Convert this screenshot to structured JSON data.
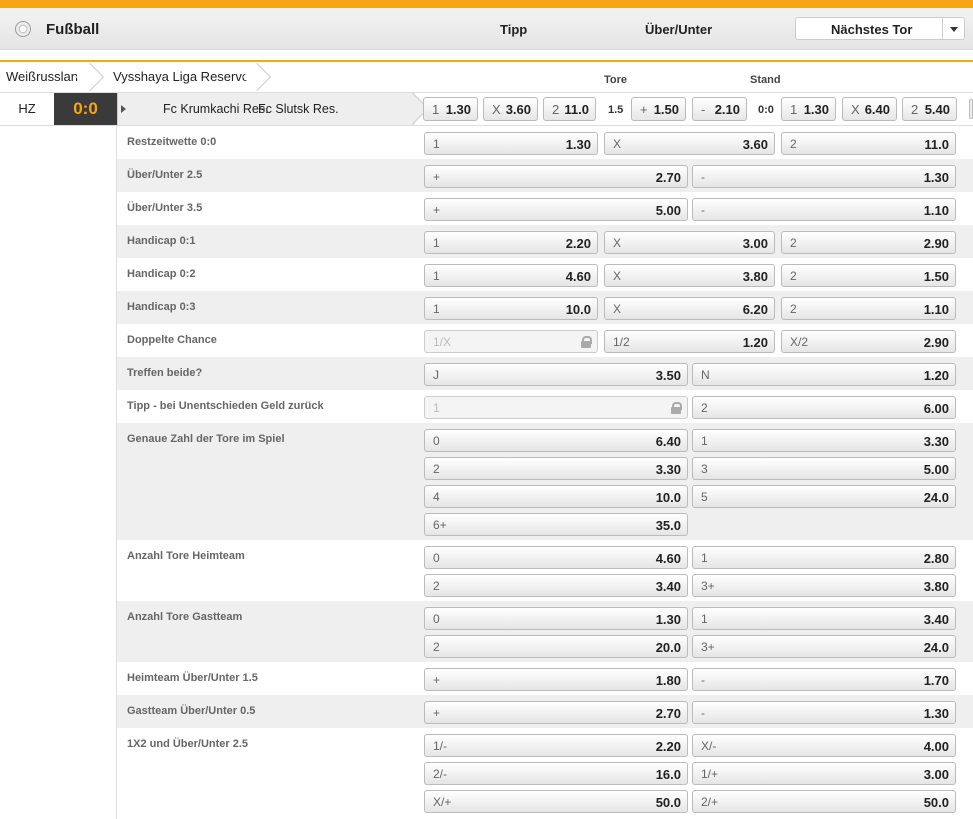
{
  "header": {
    "title": "Fußball",
    "col_tipp": "Tipp",
    "col_overunder": "Über/Unter",
    "next_goal": "Nächstes Tor",
    "accent_color": "#f7a516"
  },
  "breadcrumb": [
    "Weißrussland",
    "Vysshaya Liga Reserve"
  ],
  "col_labels": {
    "tore": "Tore",
    "stand": "Stand"
  },
  "event": {
    "period": "HZ",
    "score": "0:0",
    "home": "Fc Krumkachi Res.",
    "away": "Fc Slutsk Res.",
    "tipp": [
      {
        "l": "1",
        "o": "1.30"
      },
      {
        "l": "X",
        "o": "3.60"
      },
      {
        "l": "2",
        "o": "11.0"
      }
    ],
    "ou_line": "1.5",
    "ou": [
      {
        "l": "+",
        "o": "1.50"
      },
      {
        "l": "-",
        "o": "2.10"
      }
    ],
    "stand_line": "0:0",
    "next": [
      {
        "l": "1",
        "o": "1.30"
      },
      {
        "l": "X",
        "o": "6.40"
      },
      {
        "l": "2",
        "o": "5.40"
      }
    ]
  },
  "markets": [
    {
      "name": "Restzeitwette 0:0",
      "rows": [
        [
          {
            "l": "1",
            "o": "1.30"
          },
          {
            "l": "X",
            "o": "3.60"
          },
          {
            "l": "2",
            "o": "11.0"
          }
        ]
      ]
    },
    {
      "name": "Über/Unter 2.5",
      "rows": [
        [
          {
            "l": "+",
            "o": "2.70"
          },
          {
            "l": "-",
            "o": "1.30"
          }
        ]
      ]
    },
    {
      "name": "Über/Unter 3.5",
      "rows": [
        [
          {
            "l": "+",
            "o": "5.00"
          },
          {
            "l": "-",
            "o": "1.10"
          }
        ]
      ]
    },
    {
      "name": "Handicap 0:1",
      "rows": [
        [
          {
            "l": "1",
            "o": "2.20"
          },
          {
            "l": "X",
            "o": "3.00"
          },
          {
            "l": "2",
            "o": "2.90"
          }
        ]
      ]
    },
    {
      "name": "Handicap 0:2",
      "rows": [
        [
          {
            "l": "1",
            "o": "4.60"
          },
          {
            "l": "X",
            "o": "3.80"
          },
          {
            "l": "2",
            "o": "1.50"
          }
        ]
      ]
    },
    {
      "name": "Handicap 0:3",
      "rows": [
        [
          {
            "l": "1",
            "o": "10.0"
          },
          {
            "l": "X",
            "o": "6.20"
          },
          {
            "l": "2",
            "o": "1.10"
          }
        ]
      ]
    },
    {
      "name": "Doppelte Chance",
      "rows": [
        [
          {
            "l": "1/X",
            "o": "",
            "locked": true
          },
          {
            "l": "1/2",
            "o": "1.20"
          },
          {
            "l": "X/2",
            "o": "2.90"
          }
        ]
      ]
    },
    {
      "name": "Treffen beide?",
      "rows": [
        [
          {
            "l": "J",
            "o": "3.50"
          },
          {
            "l": "N",
            "o": "1.20"
          }
        ]
      ]
    },
    {
      "name": "Tipp - bei Unentschieden Geld zurück",
      "rows": [
        [
          {
            "l": "1",
            "o": "",
            "locked": true
          },
          {
            "l": "2",
            "o": "6.00"
          }
        ]
      ]
    },
    {
      "name": "Genaue Zahl der Tore im Spiel",
      "rows": [
        [
          {
            "l": "0",
            "o": "6.40"
          },
          {
            "l": "1",
            "o": "3.30"
          }
        ],
        [
          {
            "l": "2",
            "o": "3.30"
          },
          {
            "l": "3",
            "o": "5.00"
          }
        ],
        [
          {
            "l": "4",
            "o": "10.0"
          },
          {
            "l": "5",
            "o": "24.0"
          }
        ],
        [
          {
            "l": "6+",
            "o": "35.0"
          }
        ]
      ]
    },
    {
      "name": "Anzahl Tore Heimteam",
      "rows": [
        [
          {
            "l": "0",
            "o": "4.60"
          },
          {
            "l": "1",
            "o": "2.80"
          }
        ],
        [
          {
            "l": "2",
            "o": "3.40"
          },
          {
            "l": "3+",
            "o": "3.80"
          }
        ]
      ]
    },
    {
      "name": "Anzahl Tore Gastteam",
      "rows": [
        [
          {
            "l": "0",
            "o": "1.30"
          },
          {
            "l": "1",
            "o": "3.40"
          }
        ],
        [
          {
            "l": "2",
            "o": "20.0"
          },
          {
            "l": "3+",
            "o": "24.0"
          }
        ]
      ]
    },
    {
      "name": "Heimteam Über/Unter 1.5",
      "rows": [
        [
          {
            "l": "+",
            "o": "1.80"
          },
          {
            "l": "-",
            "o": "1.70"
          }
        ]
      ]
    },
    {
      "name": "Gastteam Über/Unter 0.5",
      "rows": [
        [
          {
            "l": "+",
            "o": "2.70"
          },
          {
            "l": "-",
            "o": "1.30"
          }
        ]
      ]
    },
    {
      "name": "1X2 und Über/Unter 2.5",
      "rows": [
        [
          {
            "l": "1/-",
            "o": "2.20"
          },
          {
            "l": "X/-",
            "o": "4.00"
          }
        ],
        [
          {
            "l": "2/-",
            "o": "16.0"
          },
          {
            "l": "1/+",
            "o": "3.00"
          }
        ],
        [
          {
            "l": "X/+",
            "o": "50.0"
          },
          {
            "l": "2/+",
            "o": "50.0"
          }
        ]
      ]
    }
  ]
}
